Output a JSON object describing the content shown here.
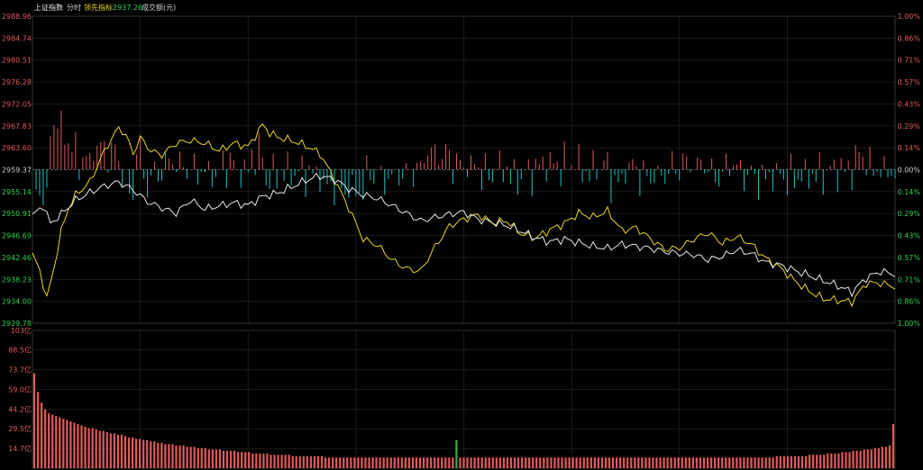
{
  "header": {
    "index_name": "上证指数",
    "view": "分时",
    "leading_label": "领先指标:",
    "leading_value": "2937.26",
    "volume_label": "成交额(元)"
  },
  "colors": {
    "background": "#000000",
    "grid": "#2a2a2a",
    "up": "#e05a5a",
    "down": "#22c1c1",
    "price_line": "#e8e8e8",
    "leading_line": "#e6d62a",
    "label_up": "#e05a5a",
    "label_down": "#2fd14f",
    "label_neutral": "#d0d0d0",
    "volume_bar": "#e05a5a",
    "volume_bar_green": "#2fb34a"
  },
  "chart_data": [
    {
      "type": "line",
      "name": "intraday",
      "yticks_left": [
        "2988.96",
        "2984.74",
        "2980.51",
        "2976.28",
        "2972.05",
        "2967.83",
        "2963.60",
        "2959.37",
        "2955.14",
        "2950.91",
        "2946.69",
        "2942.46",
        "2938.23",
        "2934.00",
        "2929.78"
      ],
      "yticks_right": [
        "1.00%",
        "0.86%",
        "0.71%",
        "0.57%",
        "0.43%",
        "0.29%",
        "0.14%",
        "0.00%",
        "0.14%",
        "0.29%",
        "0.43%",
        "0.57%",
        "0.71%",
        "0.86%",
        "1.00%"
      ],
      "ylim": [
        2929.78,
        2988.96
      ],
      "baseline": 2959.37,
      "x_minutes": 241,
      "price_keys": [
        [
          0,
          2950.5
        ],
        [
          3,
          2952.5
        ],
        [
          5,
          2949.0
        ],
        [
          8,
          2950.8
        ],
        [
          12,
          2953.5
        ],
        [
          16,
          2955.0
        ],
        [
          20,
          2956.2
        ],
        [
          24,
          2957.0
        ],
        [
          28,
          2955.5
        ],
        [
          32,
          2953.2
        ],
        [
          36,
          2952.0
        ],
        [
          40,
          2951.0
        ],
        [
          44,
          2953.5
        ],
        [
          48,
          2951.8
        ],
        [
          52,
          2952.4
        ],
        [
          56,
          2953.0
        ],
        [
          60,
          2952.5
        ],
        [
          64,
          2954.2
        ],
        [
          68,
          2954.8
        ],
        [
          72,
          2956.0
        ],
        [
          76,
          2957.3
        ],
        [
          80,
          2958.2
        ],
        [
          84,
          2957.5
        ],
        [
          88,
          2955.7
        ],
        [
          92,
          2954.5
        ],
        [
          96,
          2953.8
        ],
        [
          100,
          2952.5
        ],
        [
          104,
          2951.0
        ],
        [
          108,
          2949.5
        ],
        [
          112,
          2950.2
        ],
        [
          116,
          2950.8
        ],
        [
          120,
          2951.2
        ],
        [
          124,
          2949.8
        ],
        [
          128,
          2949.2
        ],
        [
          132,
          2948.6
        ],
        [
          136,
          2947.5
        ],
        [
          140,
          2946.2
        ],
        [
          144,
          2945.5
        ],
        [
          148,
          2946.0
        ],
        [
          152,
          2945.3
        ],
        [
          156,
          2944.6
        ],
        [
          160,
          2944.2
        ],
        [
          164,
          2945.0
        ],
        [
          168,
          2944.6
        ],
        [
          172,
          2944.2
        ],
        [
          176,
          2943.6
        ],
        [
          180,
          2943.2
        ],
        [
          184,
          2943.0
        ],
        [
          188,
          2942.0
        ],
        [
          192,
          2942.7
        ],
        [
          196,
          2943.9
        ],
        [
          200,
          2943.2
        ],
        [
          204,
          2941.5
        ],
        [
          208,
          2941.0
        ],
        [
          212,
          2940.0
        ],
        [
          216,
          2939.0
        ],
        [
          220,
          2938.0
        ],
        [
          224,
          2937.0
        ],
        [
          228,
          2935.8
        ],
        [
          232,
          2938.5
        ],
        [
          236,
          2939.8
        ],
        [
          240,
          2939.2
        ]
      ],
      "leading_keys": [
        [
          0,
          2943.0
        ],
        [
          2,
          2940.0
        ],
        [
          4,
          2934.5
        ],
        [
          6,
          2940.5
        ],
        [
          8,
          2947.5
        ],
        [
          10,
          2952.0
        ],
        [
          12,
          2954.5
        ],
        [
          16,
          2957.0
        ],
        [
          20,
          2963.0
        ],
        [
          24,
          2967.5
        ],
        [
          26,
          2966.0
        ],
        [
          28,
          2962.5
        ],
        [
          30,
          2965.5
        ],
        [
          33,
          2963.0
        ],
        [
          36,
          2962.2
        ],
        [
          40,
          2964.5
        ],
        [
          44,
          2965.0
        ],
        [
          48,
          2964.5
        ],
        [
          52,
          2963.0
        ],
        [
          56,
          2964.5
        ],
        [
          60,
          2963.8
        ],
        [
          64,
          2968.0
        ],
        [
          66,
          2966.5
        ],
        [
          68,
          2965.7
        ],
        [
          72,
          2965.0
        ],
        [
          76,
          2964.0
        ],
        [
          80,
          2962.5
        ],
        [
          84,
          2957.5
        ],
        [
          88,
          2952.0
        ],
        [
          92,
          2946.0
        ],
        [
          96,
          2944.8
        ],
        [
          100,
          2942.0
        ],
        [
          104,
          2940.3
        ],
        [
          108,
          2939.8
        ],
        [
          112,
          2944.5
        ],
        [
          116,
          2948.5
        ],
        [
          120,
          2949.8
        ],
        [
          124,
          2950.7
        ],
        [
          128,
          2949.2
        ],
        [
          132,
          2949.5
        ],
        [
          136,
          2947.0
        ],
        [
          140,
          2946.2
        ],
        [
          144,
          2947.8
        ],
        [
          148,
          2949.0
        ],
        [
          152,
          2951.0
        ],
        [
          156,
          2950.2
        ],
        [
          160,
          2951.4
        ],
        [
          164,
          2947.6
        ],
        [
          168,
          2948.2
        ],
        [
          172,
          2946.0
        ],
        [
          176,
          2944.0
        ],
        [
          180,
          2944.3
        ],
        [
          184,
          2946.0
        ],
        [
          188,
          2947.2
        ],
        [
          192,
          2945.2
        ],
        [
          196,
          2946.5
        ],
        [
          200,
          2945.0
        ],
        [
          204,
          2942.3
        ],
        [
          208,
          2940.5
        ],
        [
          212,
          2938.0
        ],
        [
          216,
          2936.0
        ],
        [
          220,
          2934.5
        ],
        [
          224,
          2934.2
        ],
        [
          228,
          2933.9
        ],
        [
          232,
          2937.5
        ],
        [
          236,
          2937.5
        ],
        [
          240,
          2936.8
        ]
      ]
    },
    {
      "type": "bar",
      "name": "volume",
      "yticks": [
        "103亿",
        "88.5亿",
        "73.7亿",
        "59.0亿",
        "44.2亿",
        "29.5亿",
        "14.7亿"
      ],
      "ylim": [
        0,
        103
      ],
      "values": [
        71,
        57,
        49,
        44,
        41,
        40,
        39,
        38,
        37,
        36,
        35,
        34,
        33,
        32,
        31,
        30,
        30,
        29,
        28,
        28,
        27,
        26,
        26,
        25,
        25,
        24,
        23,
        23,
        22,
        22,
        21,
        21,
        20,
        20,
        19,
        19,
        18,
        18,
        18,
        17,
        17,
        17,
        16,
        16,
        16,
        15,
        15,
        15,
        14,
        14,
        14,
        14,
        13,
        13,
        13,
        13,
        12,
        12,
        12,
        12,
        11,
        11,
        11,
        11,
        11,
        10,
        10,
        10,
        10,
        10,
        10,
        9,
        9,
        9,
        9,
        9,
        9,
        9,
        9,
        9,
        8,
        8,
        8,
        8,
        8,
        8,
        8,
        8,
        8,
        8,
        8,
        8,
        8,
        8,
        8,
        8,
        8,
        8,
        8,
        8,
        8,
        8,
        8,
        8,
        8,
        8,
        8,
        8,
        8,
        8,
        8,
        8,
        8,
        8,
        8,
        8,
        21,
        8,
        8,
        8,
        8,
        8,
        8,
        8,
        8,
        8,
        8,
        8,
        8,
        8,
        8,
        8,
        8,
        8,
        8,
        8,
        8,
        8,
        8,
        8,
        8,
        8,
        8,
        8,
        8,
        8,
        8,
        8,
        8,
        8,
        8,
        8,
        8,
        8,
        8,
        8,
        8,
        8,
        8,
        8,
        8,
        8,
        8,
        8,
        8,
        8,
        8,
        8,
        8,
        8,
        8,
        8,
        8,
        8,
        8,
        8,
        8,
        8,
        8,
        8,
        8,
        8,
        8,
        8,
        8,
        8,
        8,
        8,
        8,
        8,
        8,
        8,
        8,
        8,
        8,
        8,
        8,
        8,
        8,
        8,
        8,
        8,
        8,
        8,
        9,
        9,
        9,
        9,
        9,
        9,
        9,
        9,
        9,
        10,
        10,
        10,
        10,
        10,
        11,
        11,
        11,
        11,
        12,
        12,
        12,
        13,
        13,
        13,
        14,
        14,
        14,
        15,
        15,
        16,
        16,
        17,
        33
      ],
      "green_indices": [
        116,
        238
      ]
    }
  ]
}
